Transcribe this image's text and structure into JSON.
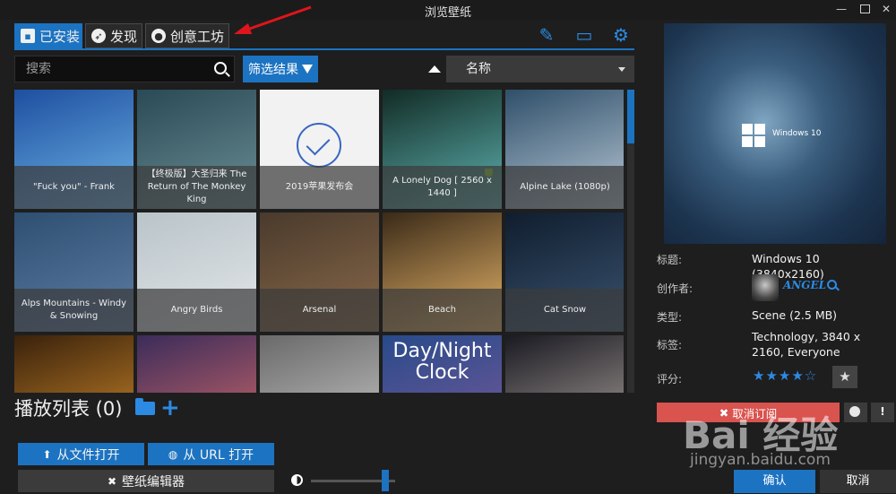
{
  "window": {
    "title": "浏览壁纸"
  },
  "tabs": [
    {
      "label": "已安装",
      "icon": "save-icon",
      "active": true
    },
    {
      "label": "发现",
      "icon": "compass-icon",
      "active": false
    },
    {
      "label": "创意工坊",
      "icon": "steam-icon",
      "active": false
    }
  ],
  "toolbar_icons": [
    "brush-icon",
    "monitor-icon",
    "gear-icon"
  ],
  "search": {
    "placeholder": "搜索"
  },
  "filter": {
    "label": "筛选结果"
  },
  "sort": {
    "selected": "名称"
  },
  "wallpapers": [
    {
      "title": "\"Fuck you\" - Frank",
      "colors": [
        "#1e4fa0",
        "#6db3e6"
      ]
    },
    {
      "title": "【终极版】大圣归来 The Return of The Monkey King",
      "colors": [
        "#2a4a55",
        "#6c8f96"
      ]
    },
    {
      "title": "2019苹果发布会",
      "colors": [
        "#f2f2f2",
        "#f2f2f2"
      ],
      "selected": true
    },
    {
      "title": "A Lonely Dog [ 2560 x 1440 ]",
      "colors": [
        "#122b25",
        "#5fb4b2"
      ],
      "award": true
    },
    {
      "title": "Alpine Lake (1080p)",
      "colors": [
        "#2f4f6a",
        "#b9c9d6"
      ]
    },
    {
      "title": "Alps Mountains - Windy & Snowing",
      "colors": [
        "#2e4e72",
        "#5f7ea3"
      ]
    },
    {
      "title": "Angry Birds",
      "colors": [
        "#b9c4c9",
        "#e3e7ea"
      ]
    },
    {
      "title": "Arsenal",
      "colors": [
        "#4a3a2c",
        "#8a6a4a"
      ]
    },
    {
      "title": "Beach",
      "colors": [
        "#3a2a18",
        "#e7b56a"
      ]
    },
    {
      "title": "Cat Snow",
      "colors": [
        "#101d2e",
        "#3a5470"
      ]
    },
    {
      "title": "",
      "colors": [
        "#3a220c",
        "#d08a2a"
      ]
    },
    {
      "title": "",
      "colors": [
        "#3b2c5a",
        "#d46a6a"
      ]
    },
    {
      "title": "",
      "colors": [
        "#6a6a6a",
        "#c9c9c9"
      ]
    },
    {
      "title": "",
      "colors": [
        "#284a8a",
        "#7a5a9a"
      ],
      "text": "Day/Night Clock"
    },
    {
      "title": "",
      "colors": [
        "#1a1a22",
        "#b0a6a0"
      ]
    }
  ],
  "playlist": {
    "label": "播放列表 (0)"
  },
  "buttons": {
    "open_file": "从文件打开",
    "open_url": "从 URL 打开",
    "editor": "壁纸编辑器",
    "unsubscribe": "取消订阅",
    "ok": "确认",
    "cancel": "取消"
  },
  "details": {
    "title_label": "标题:",
    "title_value": "Windows 10 (3840x2160)",
    "author_label": "创作者:",
    "author_name": "ANGEL",
    "type_label": "类型:",
    "type_value": "Scene (2.5 MB)",
    "tags_label": "标签:",
    "tags_value": "Technology, 3840 x 2160, Everyone",
    "rating_label": "评分:",
    "rating_stars": "★★★★☆",
    "preview_text": "Windows 10"
  },
  "slider": {
    "value": 0.88
  },
  "watermark": {
    "brand": "Bai 经验",
    "url": "jingyan.baidu.com"
  },
  "colors": {
    "accent": "#1c73c1",
    "danger": "#d9534f",
    "arrow": "#e0151b"
  }
}
